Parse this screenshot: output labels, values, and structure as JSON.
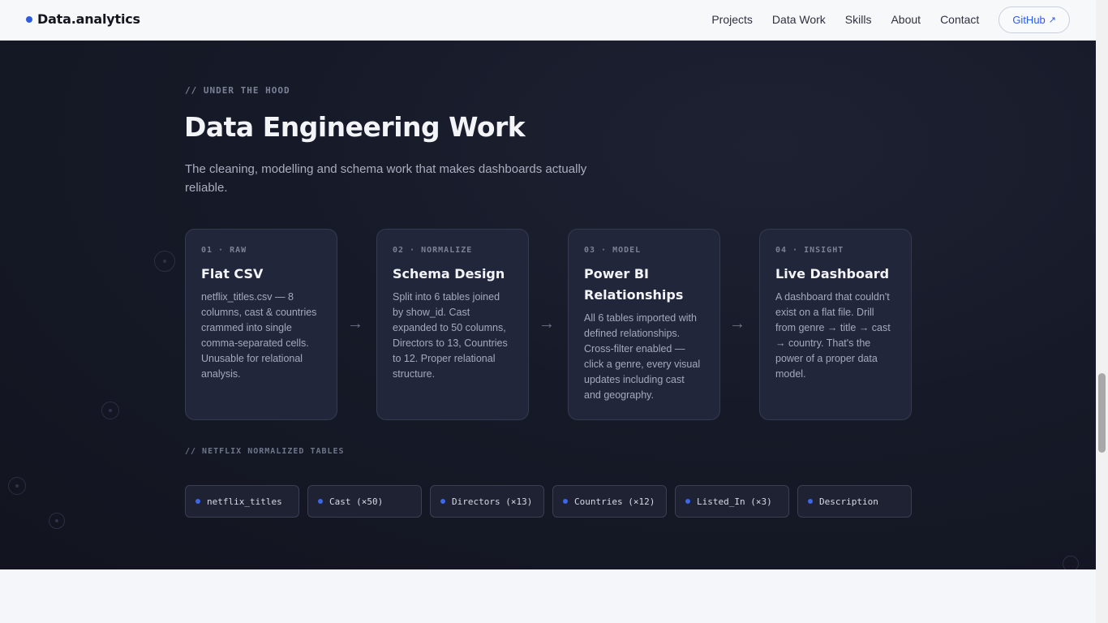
{
  "nav": {
    "brand": "Data.analytics",
    "links": [
      "Projects",
      "Data Work",
      "Skills",
      "About",
      "Contact"
    ],
    "github_label": "GitHub",
    "github_icon": "external-link-icon"
  },
  "section": {
    "eyebrow": "// UNDER THE HOOD",
    "title": "Data Engineering Work",
    "subtitle": "The cleaning, modelling and schema work that makes dashboards actually reliable."
  },
  "pipeline": [
    {
      "tag": "01 · RAW",
      "title": "Flat CSV",
      "body": "netflix_titles.csv — 8 columns, cast & countries crammed into single comma-separated cells. Unusable for relational analysis."
    },
    {
      "tag": "02 · NORMALIZE",
      "title": "Schema Design",
      "body": "Split into 6 tables joined by show_id. Cast expanded to 50 columns, Directors to 13, Countries to 12. Proper relational structure."
    },
    {
      "tag": "03 · MODEL",
      "title": "Power BI Relationships",
      "body": "All 6 tables imported with defined relationships. Cross-filter enabled — click a genre, every visual updates including cast and geography."
    },
    {
      "tag": "04 · INSIGHT",
      "title": "Live Dashboard",
      "body": "A dashboard that couldn't exist on a flat file. Drill from genre → title → cast → country. That's the power of a proper data model."
    }
  ],
  "arrow_glyph": "→",
  "tables": {
    "label": "// NETFLIX NORMALIZED TABLES",
    "items": [
      "netflix_titles",
      "Cast (×50)",
      "Directors (×13)",
      "Countries (×12)",
      "Listed_In (×3)",
      "Description"
    ]
  },
  "colors": {
    "accent": "#2f5be0",
    "dark_bg": "#161a28",
    "card_bg": "#22263a"
  }
}
